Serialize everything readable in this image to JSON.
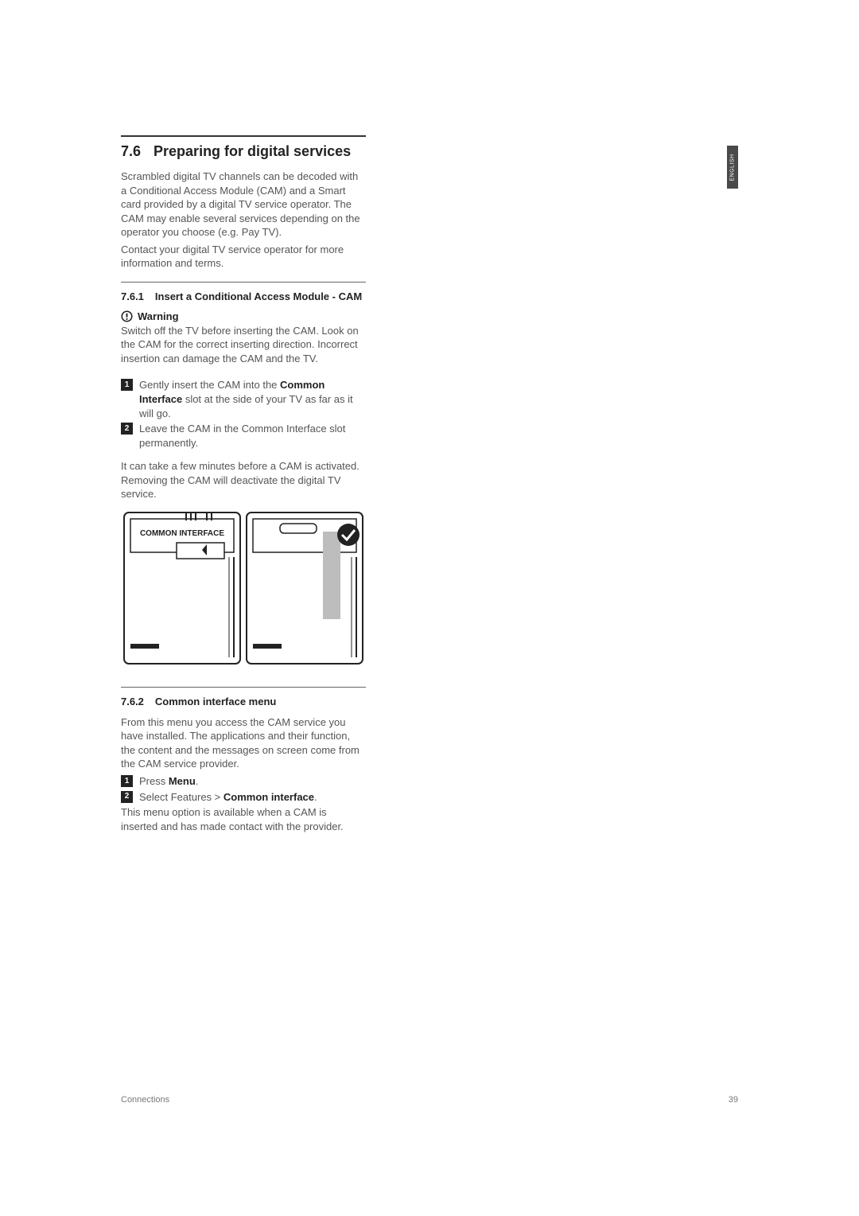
{
  "language_tab": "ENGLISH",
  "section": {
    "number": "7.6",
    "title": "Preparing for digital services"
  },
  "intro": {
    "p1": "Scrambled digital TV channels can be decoded with a Conditional Access Module (CAM) and a Smart card provided by a digital TV service operator. The CAM may enable several services depending on the operator you choose (e.g. Pay TV).",
    "p2": "Contact your digital TV service operator for more information and terms."
  },
  "sub1": {
    "number": "7.6.1",
    "title": "Insert a Conditional Access Module - CAM",
    "warning_label": "Warning",
    "warning_text": "Switch off the TV before inserting the CAM. Look on the CAM for the correct inserting direction. Incorrect insertion can damage the CAM and the TV.",
    "step1_pre": "Gently insert the CAM into the ",
    "step1_bold": "Common Interface",
    "step1_post": " slot at the side of your TV as far as it will go.",
    "step2": "Leave the CAM in the Common Interface slot permanently.",
    "post_steps": "It can take a few minutes before a CAM is activated. Removing the CAM will deactivate the digital TV service.",
    "diagram_label": "COMMON INTERFACE"
  },
  "sub2": {
    "number": "7.6.2",
    "title": "Common interface menu",
    "intro": "From this menu you access the CAM service you have installed. The applications and their function, the content and the messages on screen come from the CAM service provider.",
    "step1_pre": "Press ",
    "step1_bold": "Menu",
    "step1_post": ".",
    "step2_pre": "Select Features > ",
    "step2_bold": "Common interface",
    "step2_post": ".",
    "after": "This menu option is available when a CAM is inserted and has made contact with the provider."
  },
  "footer": {
    "left": "Connections",
    "right": "39"
  }
}
